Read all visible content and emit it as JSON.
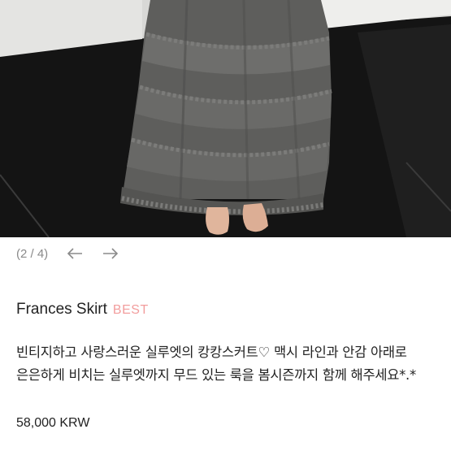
{
  "gallery": {
    "counter": "(2 / 4)",
    "prev_icon": "arrow-left-icon",
    "next_icon": "arrow-right-icon"
  },
  "product": {
    "name": "Frances Skirt",
    "badge": "BEST",
    "description": "빈티지하고 사랑스러운 실루엣의 캉캉스커트♡ 맥시 라인과 안감 아래로 은은하게 비치는 실루엣까지 무드 있는 룩을 봄시즌까지 함께 해주세요*.*",
    "price": "58,000 KRW"
  },
  "colors": {
    "badge": "#f29d9d",
    "counter": "#8a8a8a",
    "text": "#222222"
  }
}
